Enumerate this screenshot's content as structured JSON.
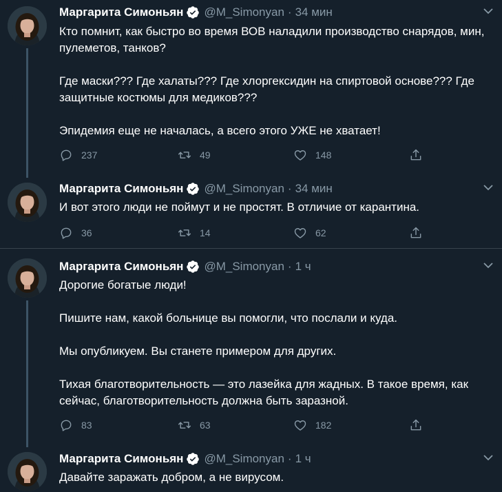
{
  "colors": {
    "background": "#15202b",
    "text": "#ffffff",
    "muted": "#8899a6",
    "verified": "#ffffff",
    "thread_line": "#3d5466",
    "divider": "#38444d"
  },
  "tweets": [
    {
      "name": "Маргарита Симоньян",
      "handle": "@M_Simonyan",
      "dot": "·",
      "time": "34 мин",
      "paragraphs": [
        "Кто помнит, как быстро во время ВОВ наладили производство снарядов, мин, пулеметов, танков?",
        "Где маски??? Где халаты??? Где хлоргексидин на спиртовой основе??? Где защитные костюмы для медиков???",
        "Эпидемия еще не началась, а всего этого УЖЕ не хватает!"
      ],
      "replies": "237",
      "retweets": "49",
      "likes": "148"
    },
    {
      "name": "Маргарита Симоньян",
      "handle": "@M_Simonyan",
      "dot": "·",
      "time": "34 мин",
      "paragraphs": [
        "И вот этого люди не поймут и не простят. В отличие от карантина."
      ],
      "replies": "36",
      "retweets": "14",
      "likes": "62"
    },
    {
      "name": "Маргарита Симоньян",
      "handle": "@M_Simonyan",
      "dot": "·",
      "time": "1 ч",
      "paragraphs": [
        "Дорогие богатые люди!",
        "Пишите нам, какой больнице вы помогли, что послали и куда.",
        "Мы опубликуем. Вы станете примером для других.",
        "Тихая благотворительность — это лазейка для жадных. В такое время, как сейчас, благотворительность должна быть заразной."
      ],
      "replies": "83",
      "retweets": "63",
      "likes": "182"
    },
    {
      "name": "Маргарита Симоньян",
      "handle": "@M_Simonyan",
      "dot": "·",
      "time": "1 ч",
      "paragraphs": [
        "Давайте заражать добром, а не вирусом."
      ]
    }
  ],
  "icons": {
    "verified": "verified-badge-icon",
    "chevron": "chevron-down-icon",
    "reply": "reply-icon",
    "retweet": "retweet-icon",
    "like": "like-icon",
    "share": "share-icon"
  }
}
